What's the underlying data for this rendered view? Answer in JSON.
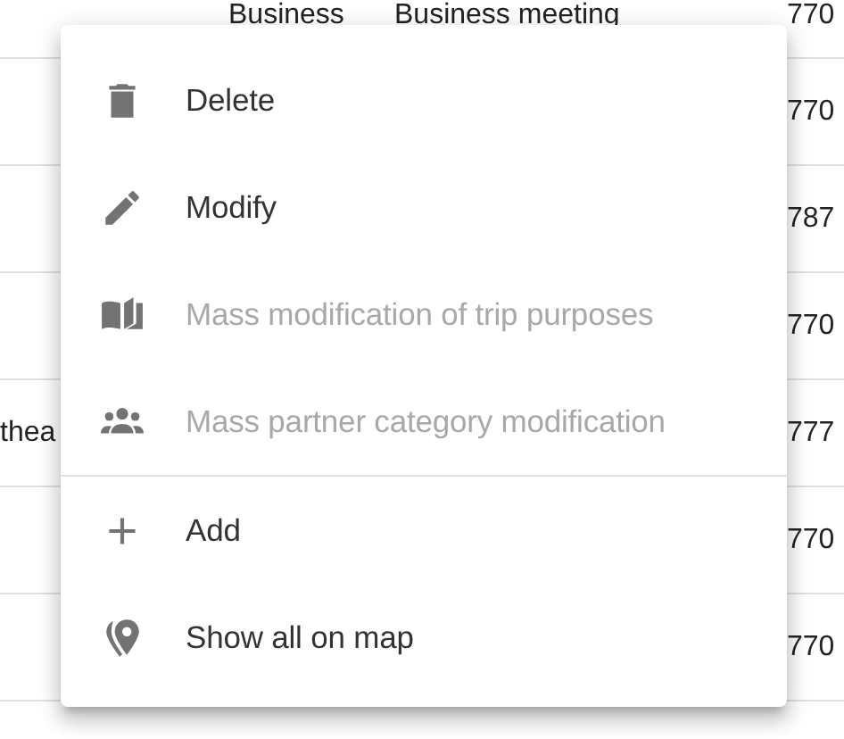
{
  "table": {
    "rows": [
      {
        "column_2": "Business",
        "column_3": "Business meeting",
        "column_4": "770"
      },
      {
        "column_4": "770"
      },
      {
        "column_4": "787"
      },
      {
        "column_4": "770"
      },
      {
        "column_1": "thea",
        "column_4": "777"
      },
      {
        "column_4": "770"
      },
      {
        "column_4": "770"
      }
    ]
  },
  "context_menu": {
    "groups": [
      {
        "items": [
          {
            "label": "Delete",
            "disabled": false
          },
          {
            "label": "Modify",
            "disabled": false
          },
          {
            "label": "Mass modification of trip purposes",
            "disabled": true
          },
          {
            "label": "Mass partner category modification",
            "disabled": true
          }
        ]
      },
      {
        "items": [
          {
            "label": "Add",
            "disabled": false
          },
          {
            "label": "Show all on map",
            "disabled": false
          }
        ]
      }
    ]
  }
}
